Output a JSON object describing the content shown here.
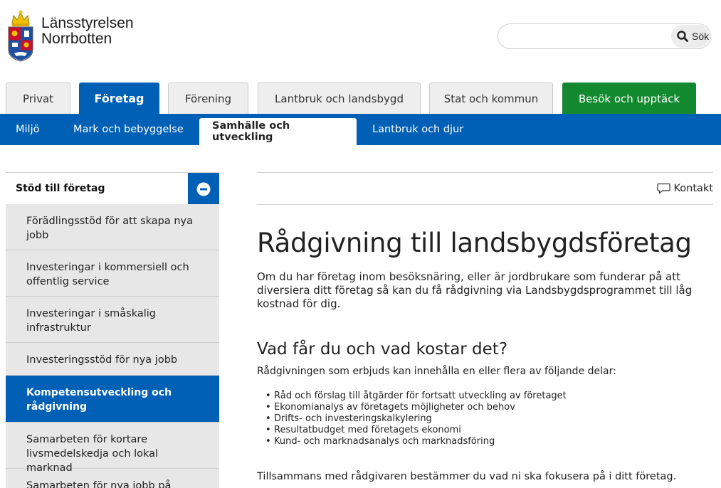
{
  "header": {
    "logo_line1": "Länsstyrelsen",
    "logo_line2": "Norrbotten",
    "search_placeholder": "",
    "search_button": "Sök"
  },
  "main_tabs": [
    {
      "label": "Privat"
    },
    {
      "label": "Företag"
    },
    {
      "label": "Förening"
    },
    {
      "label": "Lantbruk och landsbygd"
    },
    {
      "label": "Stat och kommun"
    },
    {
      "label": "Besök och upptäck"
    }
  ],
  "sub_nav": [
    {
      "label": "Miljö"
    },
    {
      "label": "Mark och bebyggelse"
    },
    {
      "label": "Samhälle och utveckling"
    },
    {
      "label": "Lantbruk och djur"
    }
  ],
  "sidebar": {
    "heading": "Stöd till företag",
    "items": [
      {
        "label": "Förädlingsstöd för att skapa nya jobb"
      },
      {
        "label": "Investeringar i kommersiell och offentlig service"
      },
      {
        "label": "Investeringar i småskalig infrastruktur"
      },
      {
        "label": "Investeringsstöd för nya jobb"
      },
      {
        "label": "Kompetensutveckling och rådgivning"
      },
      {
        "label": "Samarbeten för kortare livsmedelskedja och lokal marknad"
      },
      {
        "label": "Samarbeten för nya jobb på"
      }
    ]
  },
  "content": {
    "contact_label": "Kontakt",
    "title": "Rådgivning till landsbygdsföretag",
    "lead": "Om du har företag inom besöksnäring, eller är jordbrukare som funderar på att diversiera ditt företag så kan du få rådgivning via Landsbygdsprogrammet till låg kostnad för dig.",
    "subheading": "Vad får du och vad kostar det?",
    "intro": "Rådgivningen som erbjuds kan innehålla en eller flera av följande delar:",
    "bullets": [
      "Råd och förslag till åtgärder för fortsatt utveckling av företaget",
      "Ekonomianalys av företagets möjligheter och behov",
      "Drifts- och investeringskalkylering",
      "Resultatbudget med företagets ekonomi",
      "Kund- och marknadsanalys och marknadsföring"
    ],
    "closing": "Tillsammans med rådgivaren bestämmer du vad ni ska fokusera på i ditt företag."
  },
  "colors": {
    "brand_blue": "#0060b6",
    "green_tab": "#13892f",
    "sidebar_gray": "#e7e7e7"
  },
  "icons": {
    "crest": "coat-of-arms-icon",
    "search": "search-icon",
    "toggle": "minus-circle-icon",
    "contact": "speech-bubble-icon"
  }
}
